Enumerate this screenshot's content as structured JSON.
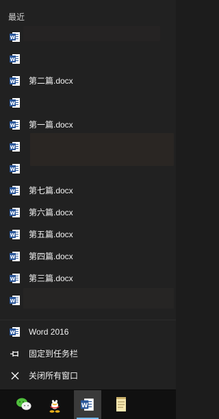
{
  "jumplist": {
    "section_title": "最近",
    "recent_items": [
      {
        "label": ""
      },
      {
        "label": ""
      },
      {
        "label": "第二篇.docx"
      },
      {
        "label": ""
      },
      {
        "label": "第一篇.docx"
      },
      {
        "label": ""
      },
      {
        "label": ""
      },
      {
        "label": "第七篇.docx"
      },
      {
        "label": "第六篇.docx"
      },
      {
        "label": "第五篇.docx"
      },
      {
        "label": "第四篇.docx"
      },
      {
        "label": "第三篇.docx"
      },
      {
        "label": ""
      }
    ],
    "actions": {
      "open_app": "Word 2016",
      "pin": "固定到任务栏",
      "close_all": "关闭所有窗口"
    }
  },
  "taskbar": {
    "icons": [
      "wechat-icon",
      "qq-icon",
      "word-icon",
      "notepad-icon"
    ],
    "active": "word-icon"
  },
  "colors": {
    "word_blue": "#2b579a",
    "accent": "#76b9ed"
  }
}
